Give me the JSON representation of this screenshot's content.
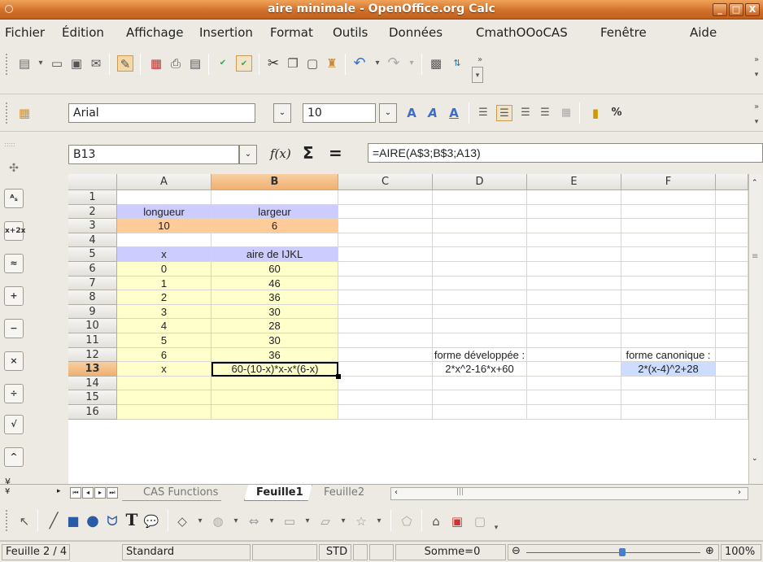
{
  "window": {
    "title": "aire minimale - OpenOffice.org Calc",
    "controls": [
      "_",
      "□",
      "X"
    ]
  },
  "menu": [
    "Fichier",
    "Édition",
    "Affichage",
    "Insertion",
    "Format",
    "Outils",
    "Données",
    "CmathOOoCAS",
    "Fenêtre",
    "Aide"
  ],
  "formatting": {
    "font_name": "Arial",
    "font_size": "10"
  },
  "formula_bar": {
    "cell_ref": "B13",
    "fx": "f(x)",
    "sigma": "Σ",
    "equals": "=",
    "formula": "=AIRE(A$3;B$3;A13)"
  },
  "columns": [
    "A",
    "B",
    "C",
    "D",
    "E",
    "F"
  ],
  "rows": [
    "1",
    "2",
    "3",
    "4",
    "5",
    "6",
    "7",
    "8",
    "9",
    "10",
    "11",
    "12",
    "13",
    "14",
    "15",
    "16"
  ],
  "cells": {
    "A2": "longueur",
    "B2": "largeur",
    "A3": "10",
    "B3": "6",
    "A5": "x",
    "B5": "aire de IJKL",
    "A6": "0",
    "B6": "60",
    "A7": "1",
    "B7": "46",
    "A8": "2",
    "B8": "36",
    "A9": "3",
    "B9": "30",
    "A10": "4",
    "B10": "28",
    "A11": "5",
    "B11": "30",
    "A12": "6",
    "B12": "36",
    "A13": "x",
    "B13": "60-(10-x)*x-x*(6-x)",
    "D12": "forme développée :",
    "F12": "forme canonique :",
    "D13": "2*x^2-16*x+60",
    "F13": "2*(x-4)^2+28"
  },
  "colors": {
    "header_row": "#ccccff",
    "input_row": "#ffcc99",
    "data_fill": "#ffffcc",
    "selected": "#f0b070",
    "canon_fill": "#ccddff"
  },
  "sheet_tabs": {
    "tabs": [
      "CAS Functions",
      "Feuille1",
      "Feuille2"
    ],
    "active": "Feuille1"
  },
  "status": {
    "sheet": "Feuille 2 / 4",
    "style": "Standard",
    "mode": "STD",
    "sum": "Somme=0",
    "zoom": "100%"
  }
}
